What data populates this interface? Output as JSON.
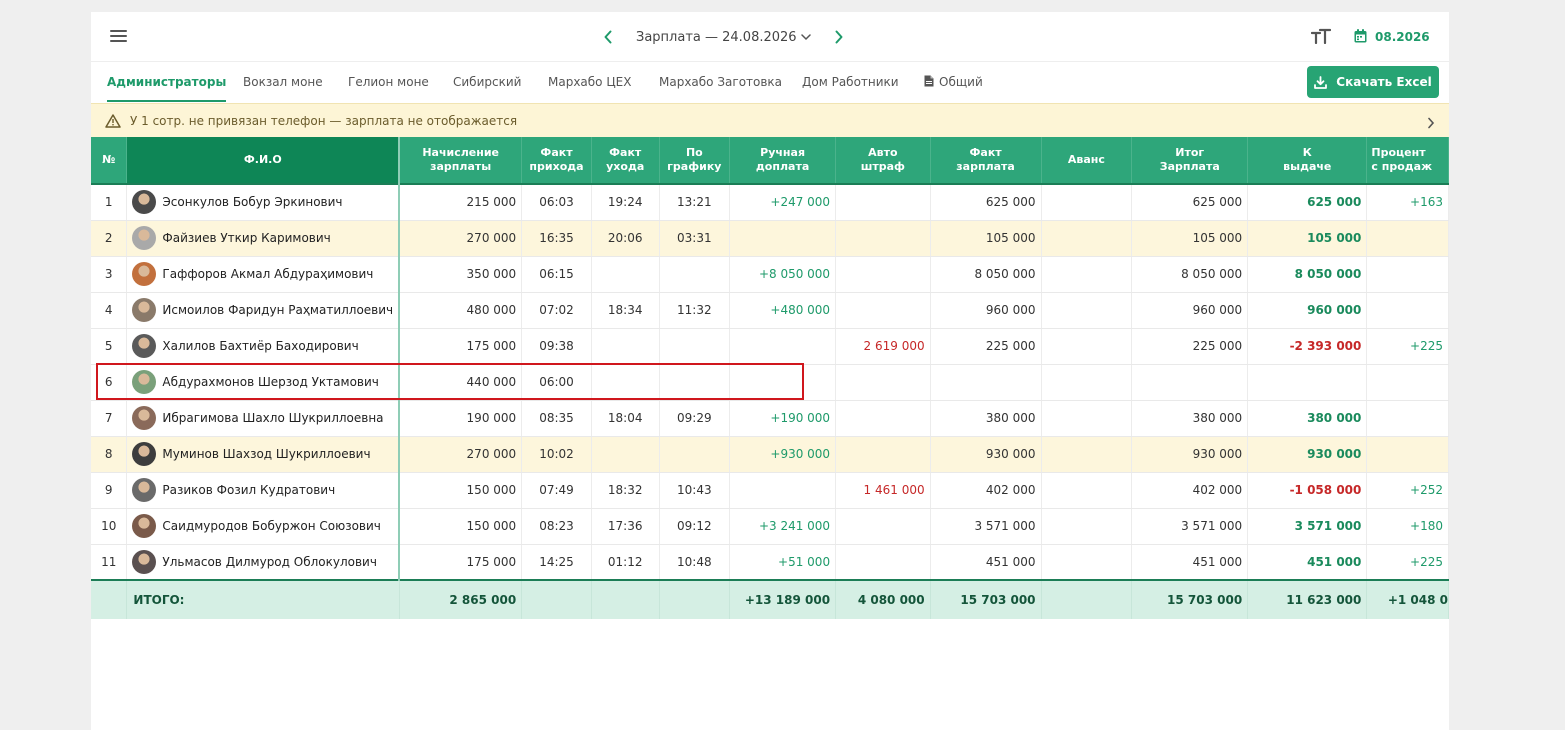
{
  "header": {
    "title": "Зарплата — 24.08.2026",
    "date": "08.2026"
  },
  "icons": {
    "menu": "menu-icon",
    "prev": "chevron-left-icon",
    "next": "chevron-right-icon",
    "dropdown": "chevron-down-icon",
    "font_size": "text-size-icon",
    "calendar": "calendar-icon",
    "download": "download-icon",
    "document": "document-icon",
    "warning": "warning-icon"
  },
  "tabs": [
    {
      "label": "Администраторы",
      "active": true
    },
    {
      "label": "Вокзал моне",
      "active": false
    },
    {
      "label": "Гелион моне",
      "active": false
    },
    {
      "label": "Сибирский",
      "active": false
    },
    {
      "label": "Мархабо ЦЕХ",
      "active": false
    },
    {
      "label": "Мархабо Заготовка",
      "active": false
    },
    {
      "label": "Дом Работники",
      "active": false
    },
    {
      "label": "Общий",
      "active": false
    }
  ],
  "excel_button": "Скачать Excel",
  "warning": "У 1 сотр. не привязан телефон — зарплата не отображается",
  "table": {
    "columns": [
      [
        "№"
      ],
      [
        "Ф.И.О"
      ],
      [
        "Начисление",
        "зарплаты"
      ],
      [
        "Факт",
        "прихода"
      ],
      [
        "Факт",
        "ухода"
      ],
      [
        "По",
        "графику"
      ],
      [
        "Ручная",
        "доплата"
      ],
      [
        "Авто",
        "штраф"
      ],
      [
        "Факт",
        "зарплата"
      ],
      [
        "Аванс"
      ],
      [
        "Итог",
        "Зарплата"
      ],
      [
        "К",
        "выдаче"
      ],
      [
        "Процент",
        "с продаж"
      ]
    ],
    "rows": [
      {
        "n": "1",
        "name": "Эсонкулов Бобур Эркинович",
        "accrual": "215 000",
        "arrival": "06:03",
        "departure": "19:24",
        "schedule": "13:21",
        "manual": "+247 000",
        "fine": "",
        "fact": "625 000",
        "advance": "",
        "total": "625 000",
        "payout": "625 000",
        "payout_neg": false,
        "percent": "+163",
        "highlight": false
      },
      {
        "n": "2",
        "name": "Файзиев Уткир Каримович",
        "accrual": "270 000",
        "arrival": "16:35",
        "departure": "20:06",
        "schedule": "03:31",
        "manual": "",
        "fine": "",
        "fact": "105 000",
        "advance": "",
        "total": "105 000",
        "payout": "105 000",
        "payout_neg": false,
        "percent": "",
        "highlight": true
      },
      {
        "n": "3",
        "name": "Гаффоров Акмал Абдураҳимович",
        "accrual": "350 000",
        "arrival": "06:15",
        "departure": "",
        "schedule": "",
        "manual": "+8 050 000",
        "fine": "",
        "fact": "8 050 000",
        "advance": "",
        "total": "8 050 000",
        "payout": "8 050 000",
        "payout_neg": false,
        "percent": "",
        "highlight": false
      },
      {
        "n": "4",
        "name": "Исмоилов Фаридун Раҳматиллоевич",
        "accrual": "480 000",
        "arrival": "07:02",
        "departure": "18:34",
        "schedule": "11:32",
        "manual": "+480 000",
        "fine": "",
        "fact": "960 000",
        "advance": "",
        "total": "960 000",
        "payout": "960 000",
        "payout_neg": false,
        "percent": "",
        "highlight": false
      },
      {
        "n": "5",
        "name": "Халилов Бахтиёр Баходирович",
        "accrual": "175 000",
        "arrival": "09:38",
        "departure": "",
        "schedule": "",
        "manual": "",
        "fine": "2 619 000",
        "fact": "225 000",
        "advance": "",
        "total": "225 000",
        "payout": "-2 393 000",
        "payout_neg": true,
        "percent": "+225",
        "highlight": false
      },
      {
        "n": "6",
        "name": "Абдурахмонов Шерзод Уктамович",
        "accrual": "440 000",
        "arrival": "06:00",
        "departure": "",
        "schedule": "",
        "manual": "",
        "fine": "",
        "fact": "",
        "advance": "",
        "total": "",
        "payout": "",
        "payout_neg": false,
        "percent": "",
        "highlight": false
      },
      {
        "n": "7",
        "name": "Ибрагимова Шахло Шукриллоевна",
        "accrual": "190 000",
        "arrival": "08:35",
        "departure": "18:04",
        "schedule": "09:29",
        "manual": "+190 000",
        "fine": "",
        "fact": "380 000",
        "advance": "",
        "total": "380 000",
        "payout": "380 000",
        "payout_neg": false,
        "percent": "",
        "highlight": false
      },
      {
        "n": "8",
        "name": "Муминов Шахзод Шукриллоевич",
        "accrual": "270 000",
        "arrival": "10:02",
        "departure": "",
        "schedule": "",
        "manual": "+930 000",
        "fine": "",
        "fact": "930 000",
        "advance": "",
        "total": "930 000",
        "payout": "930 000",
        "payout_neg": false,
        "percent": "",
        "highlight": true
      },
      {
        "n": "9",
        "name": "Разиков Фозил Кудратович",
        "accrual": "150 000",
        "arrival": "07:49",
        "departure": "18:32",
        "schedule": "10:43",
        "manual": "",
        "fine": "1 461 000",
        "fact": "402 000",
        "advance": "",
        "total": "402 000",
        "payout": "-1 058 000",
        "payout_neg": true,
        "percent": "+252",
        "highlight": false
      },
      {
        "n": "10",
        "name": "Саидмуродов Бобуржон Союзович",
        "accrual": "150 000",
        "arrival": "08:23",
        "departure": "17:36",
        "schedule": "09:12",
        "manual": "+3 241 000",
        "fine": "",
        "fact": "3 571 000",
        "advance": "",
        "total": "3 571 000",
        "payout": "3 571 000",
        "payout_neg": false,
        "percent": "+180",
        "highlight": false
      },
      {
        "n": "11",
        "name": "Ульмасов Дилмурод Облокулович",
        "accrual": "175 000",
        "arrival": "14:25",
        "departure": "01:12",
        "schedule": "10:48",
        "manual": "+51 000",
        "fine": "",
        "fact": "451 000",
        "advance": "",
        "total": "451 000",
        "payout": "451 000",
        "payout_neg": false,
        "percent": "+225",
        "highlight": false
      }
    ],
    "totals": {
      "label": "ИТОГО:",
      "accrual": "2 865 000",
      "manual": "+13 189 000",
      "fine": "4 080 000",
      "fact": "15 703 000",
      "total": "15 703 000",
      "payout": "11 623 000",
      "percent": "+1 048 0"
    }
  },
  "colors": {
    "accent": "#1e9a6a",
    "header": "#2ea67a",
    "header_dark": "#0e8656",
    "negative": "#c62828",
    "warning_bg": "#fdf5d6",
    "row_highlight": "#fdf6dc",
    "totals_bg": "#d5efe4",
    "selection_border": "#d0171d"
  }
}
